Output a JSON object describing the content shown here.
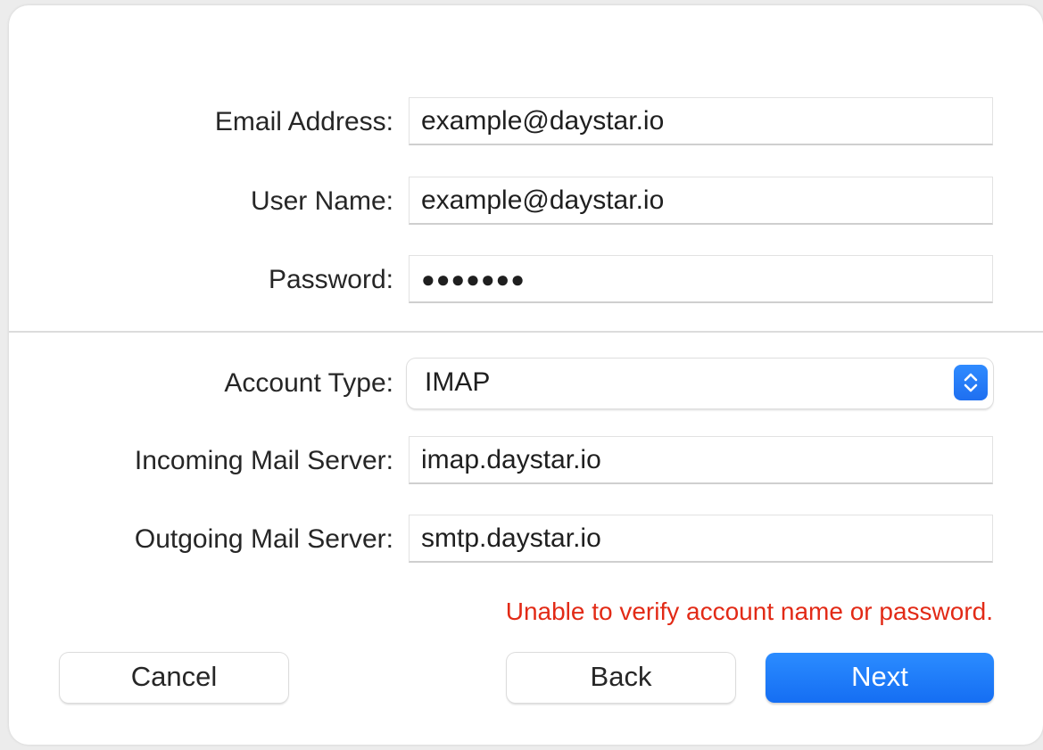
{
  "form": {
    "email_label": "Email Address:",
    "email_value": "example@daystar.io",
    "username_label": "User Name:",
    "username_value": "example@daystar.io",
    "password_label": "Password:",
    "password_value": "●●●●●●●",
    "account_type_label": "Account Type:",
    "account_type_value": "IMAP",
    "incoming_label": "Incoming Mail Server:",
    "incoming_value": "imap.daystar.io",
    "outgoing_label": "Outgoing Mail Server:",
    "outgoing_value": "smtp.daystar.io"
  },
  "error_message": "Unable to verify account name or password.",
  "buttons": {
    "cancel": "Cancel",
    "back": "Back",
    "next": "Next"
  },
  "colors": {
    "accent": "#1f6ff0",
    "error": "#e22a16"
  },
  "icons": {
    "select_stepper": "chevron-up-down-icon"
  }
}
